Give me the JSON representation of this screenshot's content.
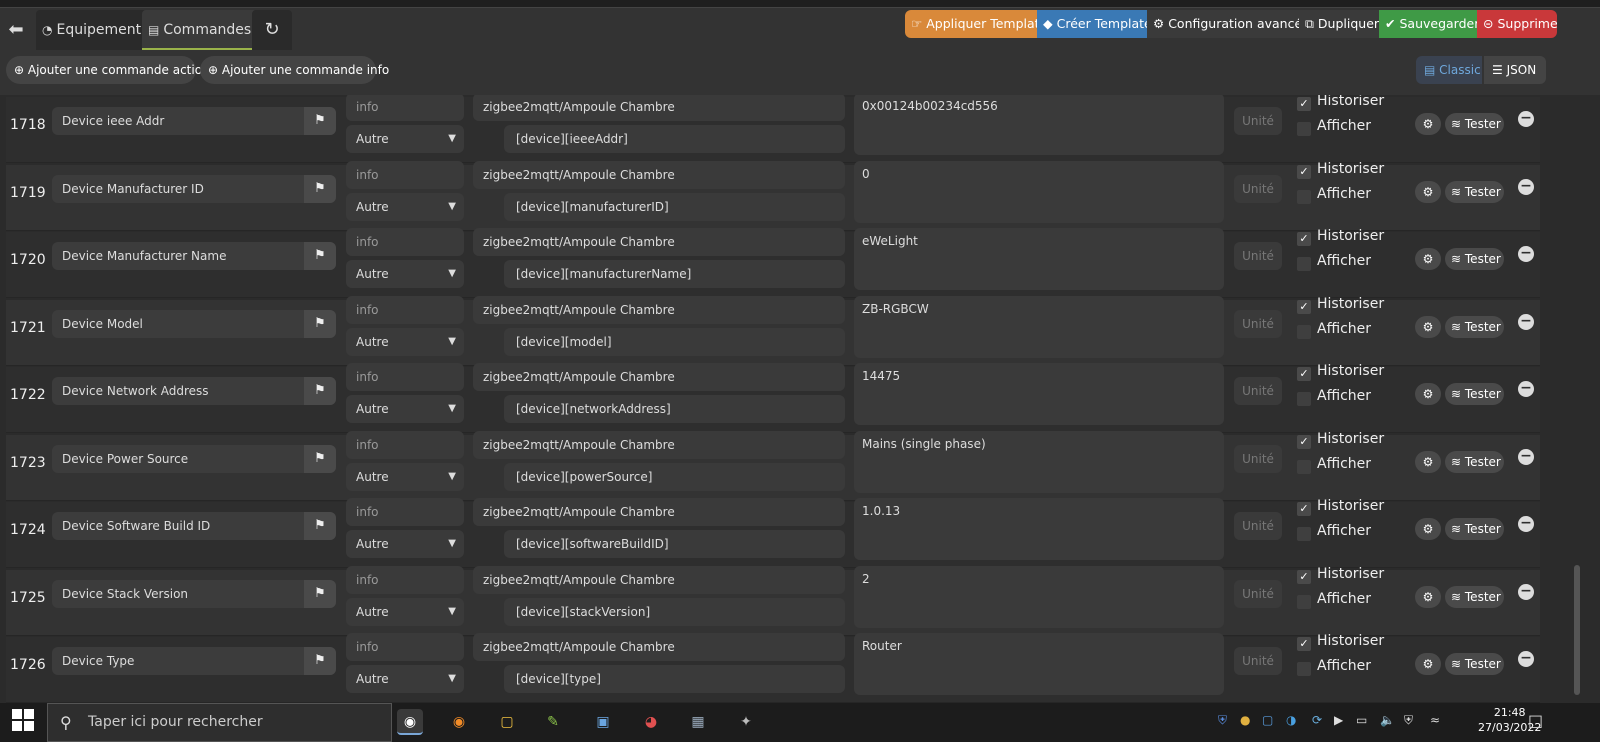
{
  "tabs": {
    "equipement": "Equipement",
    "commandes": "Commandes"
  },
  "actions": {
    "apply_template": "Appliquer Template",
    "create_template": "Créer Template",
    "advanced": "Configuration avancée",
    "duplicate": "Dupliquer",
    "save": "Sauvegarder",
    "delete": "Supprimer"
  },
  "subactions": {
    "add_action": "Ajouter une commande action",
    "add_info": "Ajouter une commande info",
    "classic": "Classic",
    "json": "JSON"
  },
  "commands": [
    {
      "id": "1718",
      "name": "Device ieee Addr",
      "type": "info",
      "subtype": "Autre",
      "topic": "zigbee2mqtt/Ampoule Chambre",
      "json": "[device][ieeeAddr]",
      "value": "0x00124b00234cd556",
      "unit": "Unité",
      "historiser": "Historiser",
      "afficher": "Afficher",
      "test": "Tester"
    },
    {
      "id": "1719",
      "name": "Device Manufacturer ID",
      "type": "info",
      "subtype": "Autre",
      "topic": "zigbee2mqtt/Ampoule Chambre",
      "json": "[device][manufacturerID]",
      "value": "0",
      "unit": "Unité",
      "historiser": "Historiser",
      "afficher": "Afficher",
      "test": "Tester"
    },
    {
      "id": "1720",
      "name": "Device Manufacturer Name",
      "type": "info",
      "subtype": "Autre",
      "topic": "zigbee2mqtt/Ampoule Chambre",
      "json": "[device][manufacturerName]",
      "value": "eWeLight",
      "unit": "Unité",
      "historiser": "Historiser",
      "afficher": "Afficher",
      "test": "Tester"
    },
    {
      "id": "1721",
      "name": "Device Model",
      "type": "info",
      "subtype": "Autre",
      "topic": "zigbee2mqtt/Ampoule Chambre",
      "json": "[device][model]",
      "value": "ZB-RGBCW",
      "unit": "Unité",
      "historiser": "Historiser",
      "afficher": "Afficher",
      "test": "Tester"
    },
    {
      "id": "1722",
      "name": "Device Network Address",
      "type": "info",
      "subtype": "Autre",
      "topic": "zigbee2mqtt/Ampoule Chambre",
      "json": "[device][networkAddress]",
      "value": "14475",
      "unit": "Unité",
      "historiser": "Historiser",
      "afficher": "Afficher",
      "test": "Tester"
    },
    {
      "id": "1723",
      "name": "Device Power Source",
      "type": "info",
      "subtype": "Autre",
      "topic": "zigbee2mqtt/Ampoule Chambre",
      "json": "[device][powerSource]",
      "value": "Mains (single phase)",
      "unit": "Unité",
      "historiser": "Historiser",
      "afficher": "Afficher",
      "test": "Tester"
    },
    {
      "id": "1724",
      "name": "Device Software Build ID",
      "type": "info",
      "subtype": "Autre",
      "topic": "zigbee2mqtt/Ampoule Chambre",
      "json": "[device][softwareBuildID]",
      "value": "1.0.13",
      "unit": "Unité",
      "historiser": "Historiser",
      "afficher": "Afficher",
      "test": "Tester"
    },
    {
      "id": "1725",
      "name": "Device Stack Version",
      "type": "info",
      "subtype": "Autre",
      "topic": "zigbee2mqtt/Ampoule Chambre",
      "json": "[device][stackVersion]",
      "value": "2",
      "unit": "Unité",
      "historiser": "Historiser",
      "afficher": "Afficher",
      "test": "Tester"
    },
    {
      "id": "1726",
      "name": "Device Type",
      "type": "info",
      "subtype": "Autre",
      "topic": "zigbee2mqtt/Ampoule Chambre",
      "json": "[device][type]",
      "value": "Router",
      "unit": "Unité",
      "historiser": "Historiser",
      "afficher": "Afficher",
      "test": "Tester"
    }
  ],
  "taskbar": {
    "search_placeholder": "Taper ici pour rechercher",
    "time": "21:48",
    "date": "27/03/2022"
  },
  "colors": {
    "apply": "#d9893a",
    "create": "#3a79b5",
    "save": "#3f9a46",
    "delete": "#c9383a",
    "tab_active": "#9ab34a"
  }
}
